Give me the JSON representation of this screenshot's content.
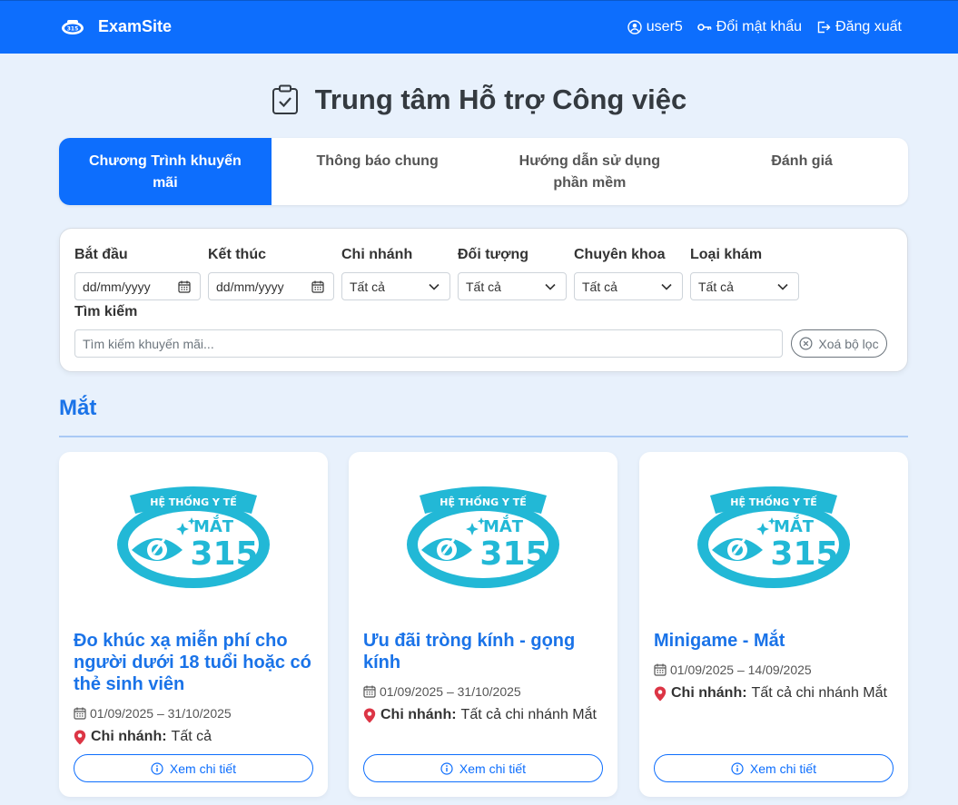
{
  "navbar": {
    "brand": "ExamSite",
    "user": "user5",
    "change_password": "Đổi mật khẩu",
    "logout": "Đăng xuất"
  },
  "page": {
    "title": "Trung tâm Hỗ trợ Công việc"
  },
  "tabs": [
    {
      "label": "Chương Trình khuyến mãi",
      "active": true
    },
    {
      "label": "Thông báo chung",
      "active": false
    },
    {
      "label": "Hướng dẫn sử dụng phần mềm",
      "active": false
    },
    {
      "label": "Đánh giá",
      "active": false
    }
  ],
  "filters": {
    "start_label": "Bắt đầu",
    "start_value": "dd/mm/yyyy",
    "end_label": "Kết thúc",
    "end_value": "dd/mm/yyyy",
    "branch_label": "Chi nhánh",
    "branch_value": "Tất cả",
    "target_label": "Đối tượng",
    "target_value": "Tất cả",
    "specialty_label": "Chuyên khoa",
    "specialty_value": "Tất cả",
    "exam_type_label": "Loại khám",
    "exam_type_value": "Tất cả",
    "search_label": "Tìm kiếm",
    "search_placeholder": "Tìm kiếm khuyến mãi...",
    "clear_label": "Xoá bộ lọc"
  },
  "section": {
    "title": "Mắt"
  },
  "logo_text": {
    "top": "HỆ THỐNG Y TẾ",
    "name": "MẮT",
    "number": "315"
  },
  "cards": [
    {
      "title": "Đo khúc xạ miễn phí cho người dưới 18 tuổi hoặc có thẻ sinh viên",
      "date": "01/09/2025 – 31/10/2025",
      "branch_label": "Chi nhánh:",
      "branch_value": "Tất cả",
      "button": "Xem chi tiết"
    },
    {
      "title": "Ưu đãi tròng kính - gọng kính",
      "date": "01/09/2025 – 31/10/2025",
      "branch_label": "Chi nhánh:",
      "branch_value": "Tất cả chi nhánh Mắt",
      "button": "Xem chi tiết"
    },
    {
      "title": "Minigame - Mắt",
      "date": "01/09/2025 – 14/09/2025",
      "branch_label": "Chi nhánh:",
      "branch_value": "Tất cả chi nhánh Mắt",
      "button": "Xem chi tiết"
    }
  ],
  "colors": {
    "primary": "#0d6efd",
    "accent_text": "#1a73e8",
    "logo": "#22b8d6",
    "pin": "#dc3545",
    "background": "#e8f1fc"
  }
}
